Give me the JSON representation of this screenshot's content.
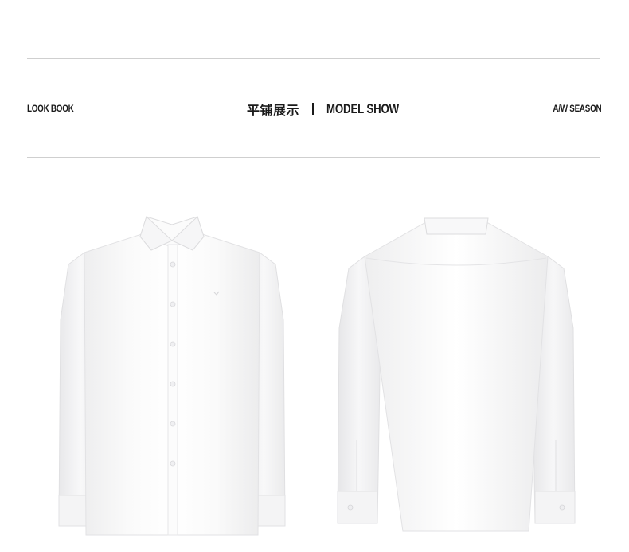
{
  "header": {
    "left_label": "LOOK BOOK",
    "title_cn": "平铺展示",
    "separator": "|",
    "title_en": "MODEL SHOW",
    "right_label": "A/W SEASON"
  },
  "products": {
    "front_view": "shirt-front",
    "back_view": "shirt-back",
    "color": "#ffffff"
  }
}
